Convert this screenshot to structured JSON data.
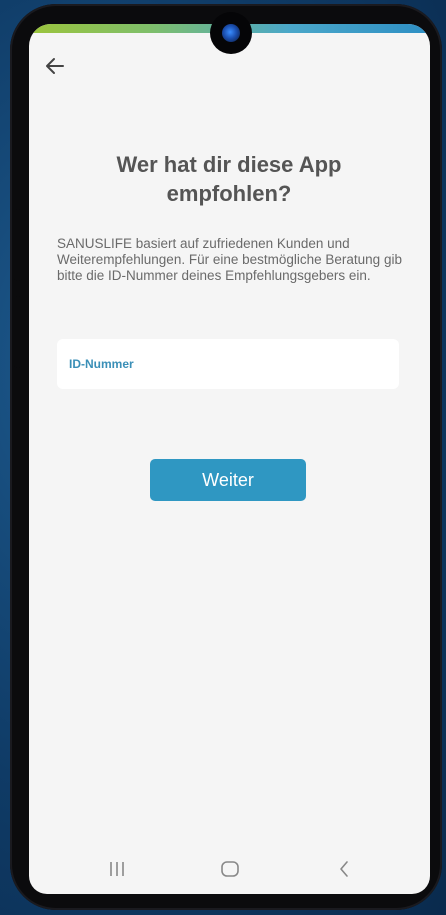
{
  "header": {
    "back_icon": "arrow-left-icon"
  },
  "main": {
    "title": "Wer hat dir diese App empfohlen?",
    "description": "SANUSLIFE basiert auf zufriedenen Kunden und Weiterempfehlungen. Für eine bestmögliche Beratung gib bitte die ID-Nummer deines Empfehlungsgebers ein.",
    "id_field": {
      "label": "ID-Nummer",
      "value": ""
    },
    "continue_label": "Weiter"
  },
  "navbar": {
    "recents_icon": "recent-apps-icon",
    "home_icon": "home-icon",
    "back_icon": "back-chevron-icon"
  },
  "colors": {
    "accent": "#2f97c2",
    "label_accent": "#3a8fb7",
    "screen_bg": "#f5f5f5",
    "text_dark": "#555555",
    "text_body": "#6a6a6a"
  }
}
